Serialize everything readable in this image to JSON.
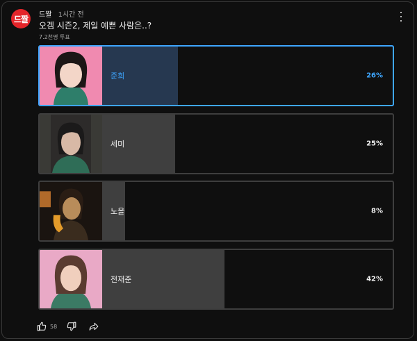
{
  "post": {
    "channel_avatar_text": "드짤",
    "channel_name": "드짤",
    "time": "1시간 전",
    "question": "오겜 시즌2, 제일 예쁜 사람은..?",
    "votes": "7.2천명 투표"
  },
  "poll": {
    "options": [
      {
        "label": "준희",
        "percent": "26%",
        "value": 26,
        "selected": true
      },
      {
        "label": "세미",
        "percent": "25%",
        "value": 25,
        "selected": false
      },
      {
        "label": "노을",
        "percent": "8%",
        "value": 8,
        "selected": false
      },
      {
        "label": "전재준",
        "percent": "42%",
        "value": 42,
        "selected": false
      }
    ]
  },
  "actions": {
    "like_count": "58",
    "like_icon": "thumbs-up-icon",
    "dislike_icon": "thumbs-down-icon",
    "share_icon": "share-icon",
    "more_icon": "more-vert-icon"
  },
  "colors": {
    "accent": "#3ea6ff",
    "selected_fill": "#263850",
    "fill": "#3f3f3f",
    "avatar": "#e4252a"
  }
}
